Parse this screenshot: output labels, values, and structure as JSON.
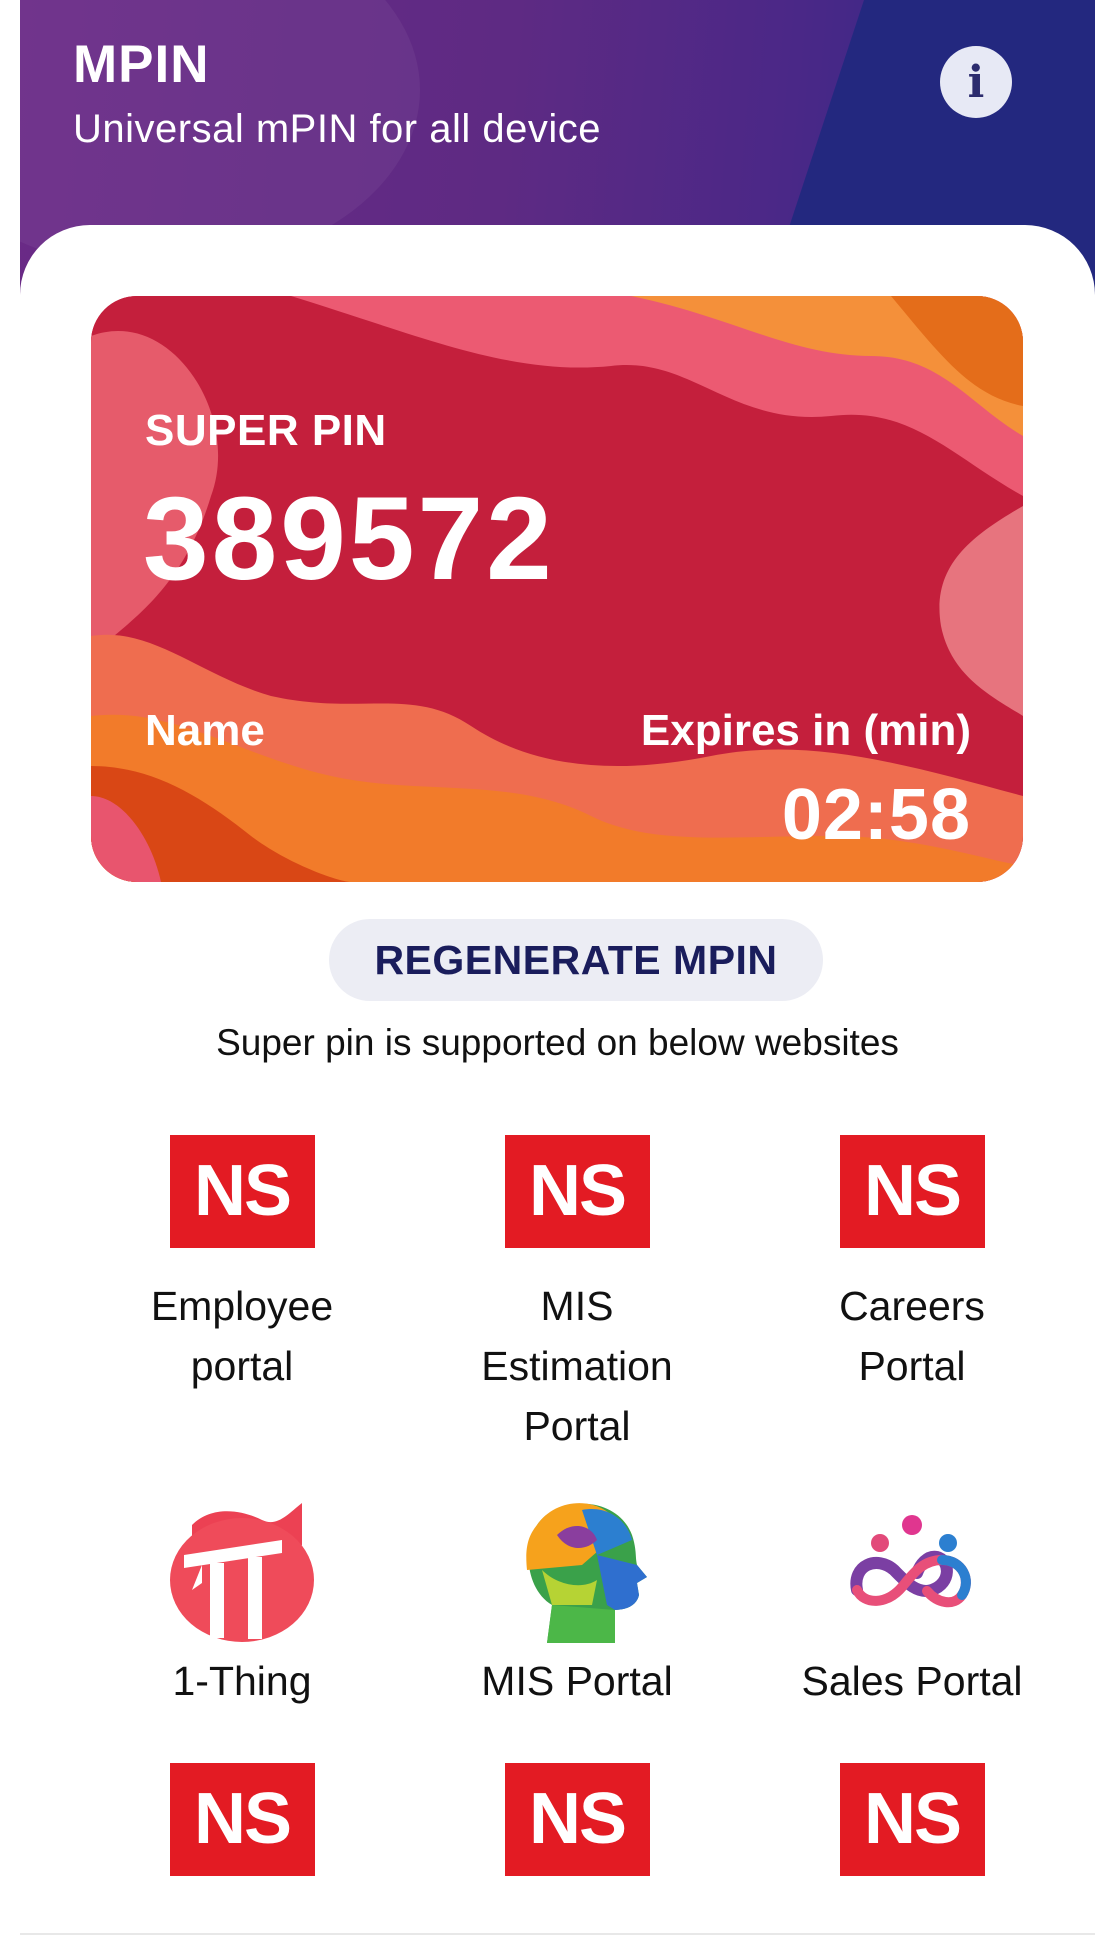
{
  "header": {
    "title": "MPIN",
    "subtitle": "Universal mPIN for all device",
    "info_icon": "info-icon",
    "info_glyph": "i"
  },
  "card": {
    "super_pin_label": "SUPER PIN",
    "super_pin_value": "389572",
    "name_label": "Name",
    "expires_label": "Expires in (min)",
    "timer": "02:58"
  },
  "regenerate_label": "REGENERATE MPIN",
  "supported_text": "Super pin is supported on below websites",
  "apps": [
    {
      "label_lines": [
        "Employee",
        "portal"
      ],
      "icon": "ns-logo-icon",
      "logo_text": "NS"
    },
    {
      "label_lines": [
        "MIS",
        "Estimation",
        "Portal"
      ],
      "icon": "ns-logo-icon",
      "logo_text": "NS"
    },
    {
      "label_lines": [
        "Careers",
        "Portal"
      ],
      "icon": "ns-logo-icon",
      "logo_text": "NS"
    },
    {
      "label_lines": [
        "1-Thing"
      ],
      "icon": "1-thing-logo-icon"
    },
    {
      "label_lines": [
        "MIS Portal"
      ],
      "icon": "head-profile-logo-icon"
    },
    {
      "label_lines": [
        "Sales Portal"
      ],
      "icon": "people-infinity-logo-icon"
    },
    {
      "label_lines": [],
      "icon": "ns-logo-icon",
      "logo_text": "NS"
    },
    {
      "label_lines": [],
      "icon": "ns-logo-icon",
      "logo_text": "NS"
    },
    {
      "label_lines": [],
      "icon": "ns-logo-icon",
      "logo_text": "NS"
    }
  ],
  "colors": {
    "header_purple": "#5e2a83",
    "header_blue": "#23287f",
    "card_red": "#c4203d",
    "ns_red": "#e31b23",
    "button_bg": "#ecedf4",
    "button_text": "#1a1d5c"
  }
}
